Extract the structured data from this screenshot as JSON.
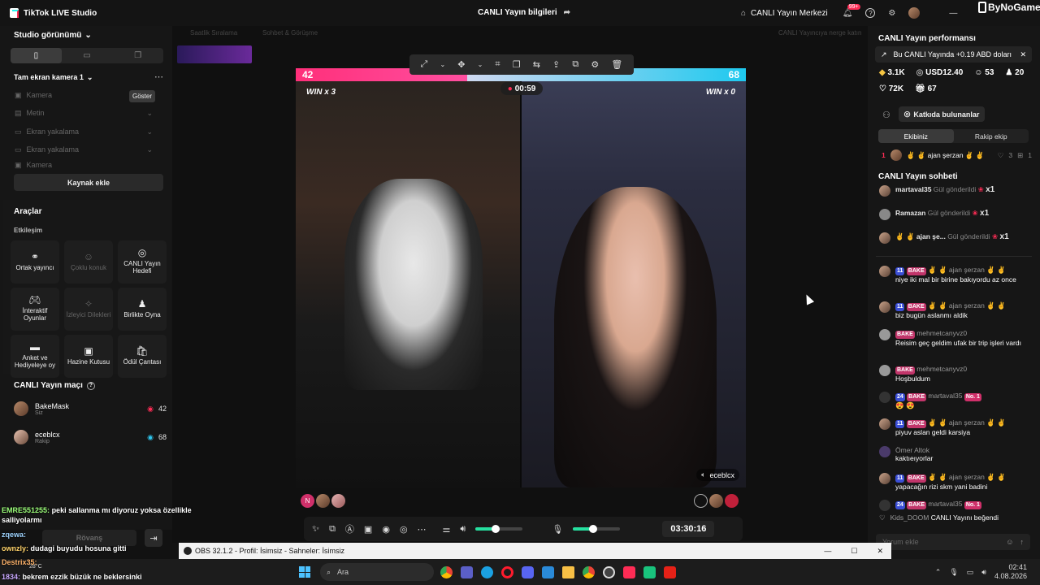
{
  "titlebar": {
    "app_name": "TikTok LIVE Studio",
    "center_title": "CANLI Yayın bilgileri",
    "live_center": "CANLI Yayın Merkezi",
    "notif_count": "99+",
    "watermark": "ByNoGame"
  },
  "left": {
    "studio_view": "Studio görünümü",
    "scene_title": "Tam ekran kamera 1",
    "sources": [
      "Kamera",
      "Metin",
      "Ekran yakalama",
      "Ekran yakalama",
      "Kamera"
    ],
    "tooltip": "Göster",
    "add_source": "Kaynak ekle",
    "tools_title": "Araçlar",
    "interaction": "Etkileşim",
    "tools": [
      {
        "label": "Ortak yayıncı",
        "dim": false
      },
      {
        "label": "Çoklu konuk",
        "dim": true
      },
      {
        "label": "CANLI Yayın Hedefi",
        "dim": false
      },
      {
        "label": "İnteraktif Oyunlar",
        "dim": false
      },
      {
        "label": "İzleyici Dilekleri",
        "dim": true
      },
      {
        "label": "Birlikte Oyna",
        "dim": false
      },
      {
        "label": "Anket ve Hediyeleye oy",
        "dim": false
      },
      {
        "label": "Hazine Kutusu",
        "dim": false
      },
      {
        "label": "Ödül Çantası",
        "dim": false
      }
    ],
    "match_title": "CANLI Yayın maçı",
    "match": [
      {
        "name": "BakeMask",
        "role": "Siz",
        "score": "42"
      },
      {
        "name": "eceblcx",
        "role": "Rakip",
        "score": "68"
      }
    ],
    "rovans": "Rövanş"
  },
  "center": {
    "top_labels": [
      "Saatlik Sıralama",
      "Sohbet & Görüşme",
      "CANLI Yayıncıya nerge katın"
    ],
    "score_left": "42",
    "score_right": "68",
    "win_left": "WIN x 3",
    "win_right": "WIN x 0",
    "timer": "00:59",
    "opponent_tag": "eceblcx",
    "duration": "03:30:16",
    "volume_level": 0.42,
    "mic_level": 0.42
  },
  "right": {
    "perf_title": "CANLI Yayın performansı",
    "perf_banner": "Bu CANLI Yayında +0.19 ABD doları",
    "stats": [
      "3.1K",
      "USD12.40",
      "53",
      "20",
      "72K",
      "67"
    ],
    "contributors": "Katkıda bulunanlar",
    "tab_our": "Ekibiniz",
    "tab_rival": "Rakip ekip",
    "top_rank": "1",
    "top_name": "✌ ✌ ajan şerzan ✌ ✌",
    "top_count1": "3",
    "top_count2": "1",
    "chat_title": "CANLI Yayın sohbeti",
    "gifts": [
      {
        "user": "martaval35",
        "action": "Gül gönderildi",
        "count": "x1"
      },
      {
        "user": "Ramazan",
        "action": "Gül gönderildi",
        "count": "x1"
      },
      {
        "user": "✌ ✌ ajan şe...",
        "action": "Gül gönderildi",
        "count": "x1"
      }
    ],
    "messages": [
      {
        "lvl": "11",
        "bake": "BAKE",
        "user": "✌ ✌ ajan şerzan ✌ ✌",
        "text": "niye iki mal bir birine bakıyordu az once"
      },
      {
        "lvl": "11",
        "bake": "BAKE",
        "user": "✌ ✌ ajan şerzan ✌ ✌",
        "text": "biz bugün aslanmı aldik"
      },
      {
        "lvl": "",
        "bake": "BAKE",
        "user": "mehmetcanyvz0",
        "text": "Reisim geç geldim ufak bir trip işleri vardı"
      },
      {
        "lvl": "",
        "bake": "BAKE",
        "user": "mehmetcanyvz0",
        "text": "Hoşbuldum"
      },
      {
        "lvl": "24",
        "bake": "BAKE",
        "user": "martaval35",
        "no1": "No. 1",
        "text": "😍 😍"
      },
      {
        "lvl": "11",
        "bake": "BAKE",
        "user": "✌ ✌ ajan şerzan ✌ ✌",
        "text": "piyuv aslan geldi karsiya"
      },
      {
        "lvl": "",
        "bake": "",
        "user": "Ömer Altok",
        "text": "kaktıeıyorlar"
      },
      {
        "lvl": "11",
        "bake": "BAKE",
        "user": "✌ ✌ ajan şerzan ✌ ✌",
        "text": "yapacağın rizi skm yani badini"
      },
      {
        "lvl": "24",
        "bake": "BAKE",
        "user": "martaval35",
        "no1": "No. 1",
        "text": ""
      }
    ],
    "like_user": "Kids_DOOM",
    "like_text": "CANLI Yayını beğendi",
    "comment_placeholder": "Yorum ekle"
  },
  "overlay_chat": [
    {
      "user": "EMRE551255:",
      "text": "peki sallanma mı diyoruz yoksa özellikle salliyolarmı"
    },
    {
      "user": "zqewa:",
      "text": ""
    },
    {
      "user": "ownzly:",
      "text": "dudagi buyudu hosuna gitti"
    },
    {
      "user": "Destrix35:",
      "text": ""
    },
    {
      "user": "1834:",
      "text": "bekrem ezzik büzük ne beklersinki"
    }
  ],
  "obs": {
    "title": "OBS 32.1.2 - Profil: İsimsiz - Sahneler: İsimsiz"
  },
  "taskbar": {
    "search": "Ara",
    "weather": "28°C",
    "time": "02:41",
    "date": "4.08.2026"
  }
}
